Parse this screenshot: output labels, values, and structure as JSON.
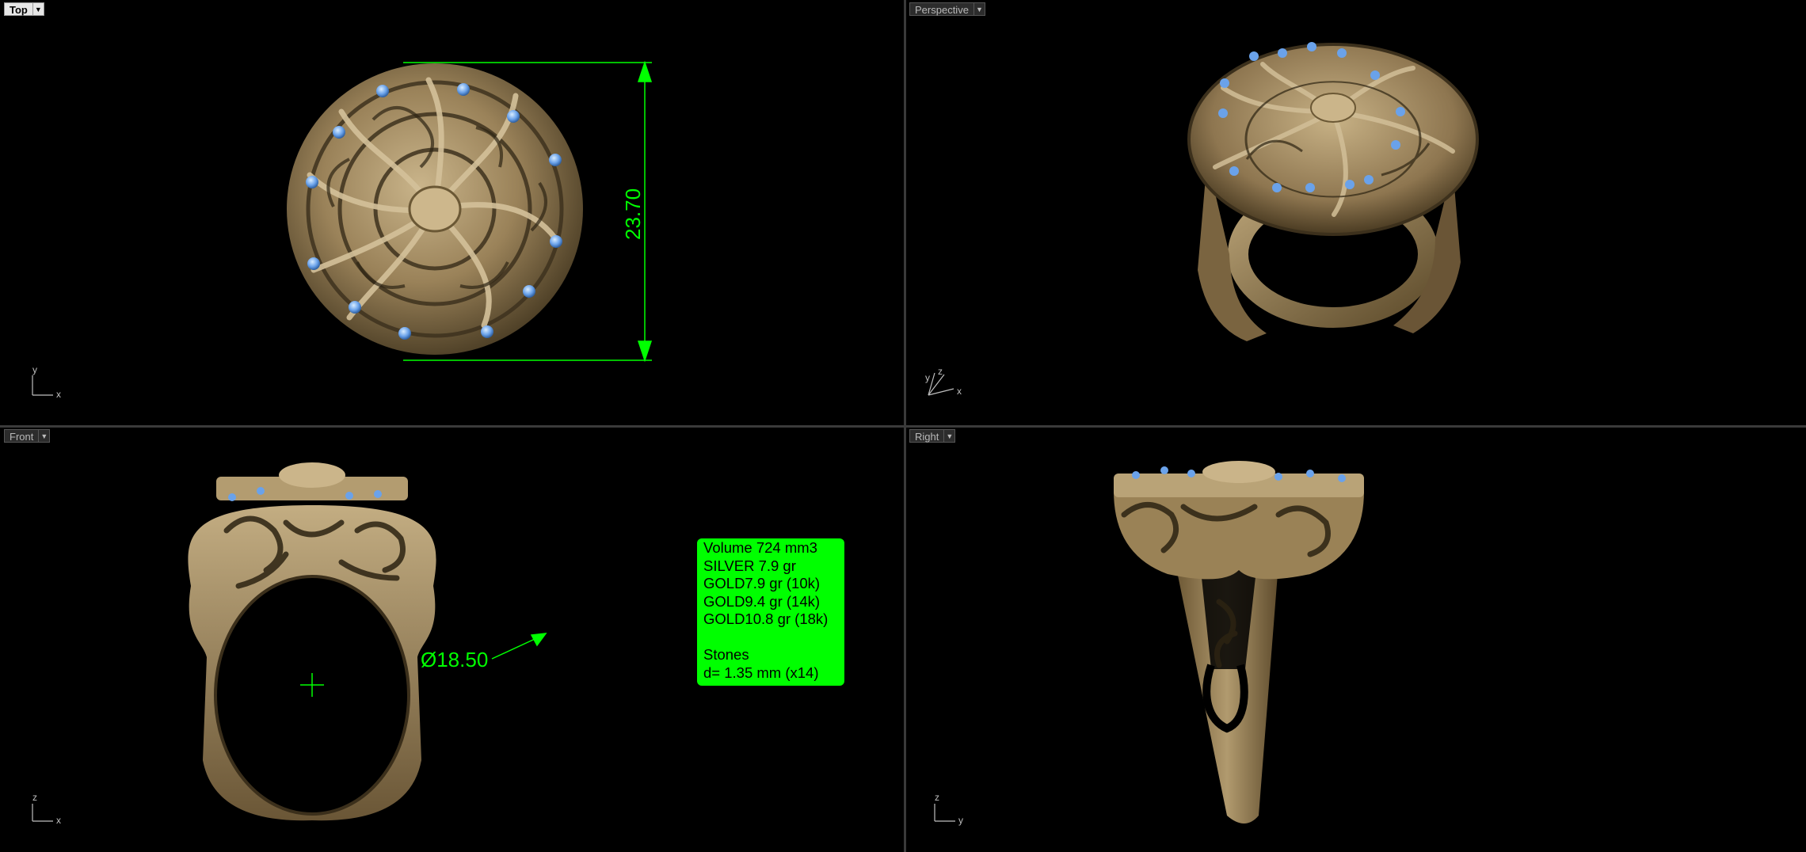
{
  "viewports": {
    "top": {
      "label": "Top",
      "axes": [
        "y",
        "x"
      ]
    },
    "perspective": {
      "label": "Perspective",
      "axes": [
        "z",
        "y",
        "x"
      ]
    },
    "front": {
      "label": "Front",
      "axes": [
        "z",
        "x"
      ]
    },
    "right": {
      "label": "Right",
      "axes": [
        "z",
        "y"
      ]
    }
  },
  "dimensions": {
    "height": "23.70",
    "ring_diameter": "Ø18.50"
  },
  "info_box": {
    "lines": [
      "Volume 724 mm3",
      "SILVER 7.9 gr",
      "GOLD7.9 gr (10k)",
      "GOLD9.4 gr (14k)",
      "GOLD10.8 gr (18k)",
      "",
      "Stones",
      "d= 1.35 mm (x14)"
    ]
  },
  "colors": {
    "dimension": "#00ff00",
    "metal": "#a89066",
    "metal_dark": "#5a4a30",
    "stone": "#6aa2ea",
    "viewport_bg": "#000000"
  }
}
